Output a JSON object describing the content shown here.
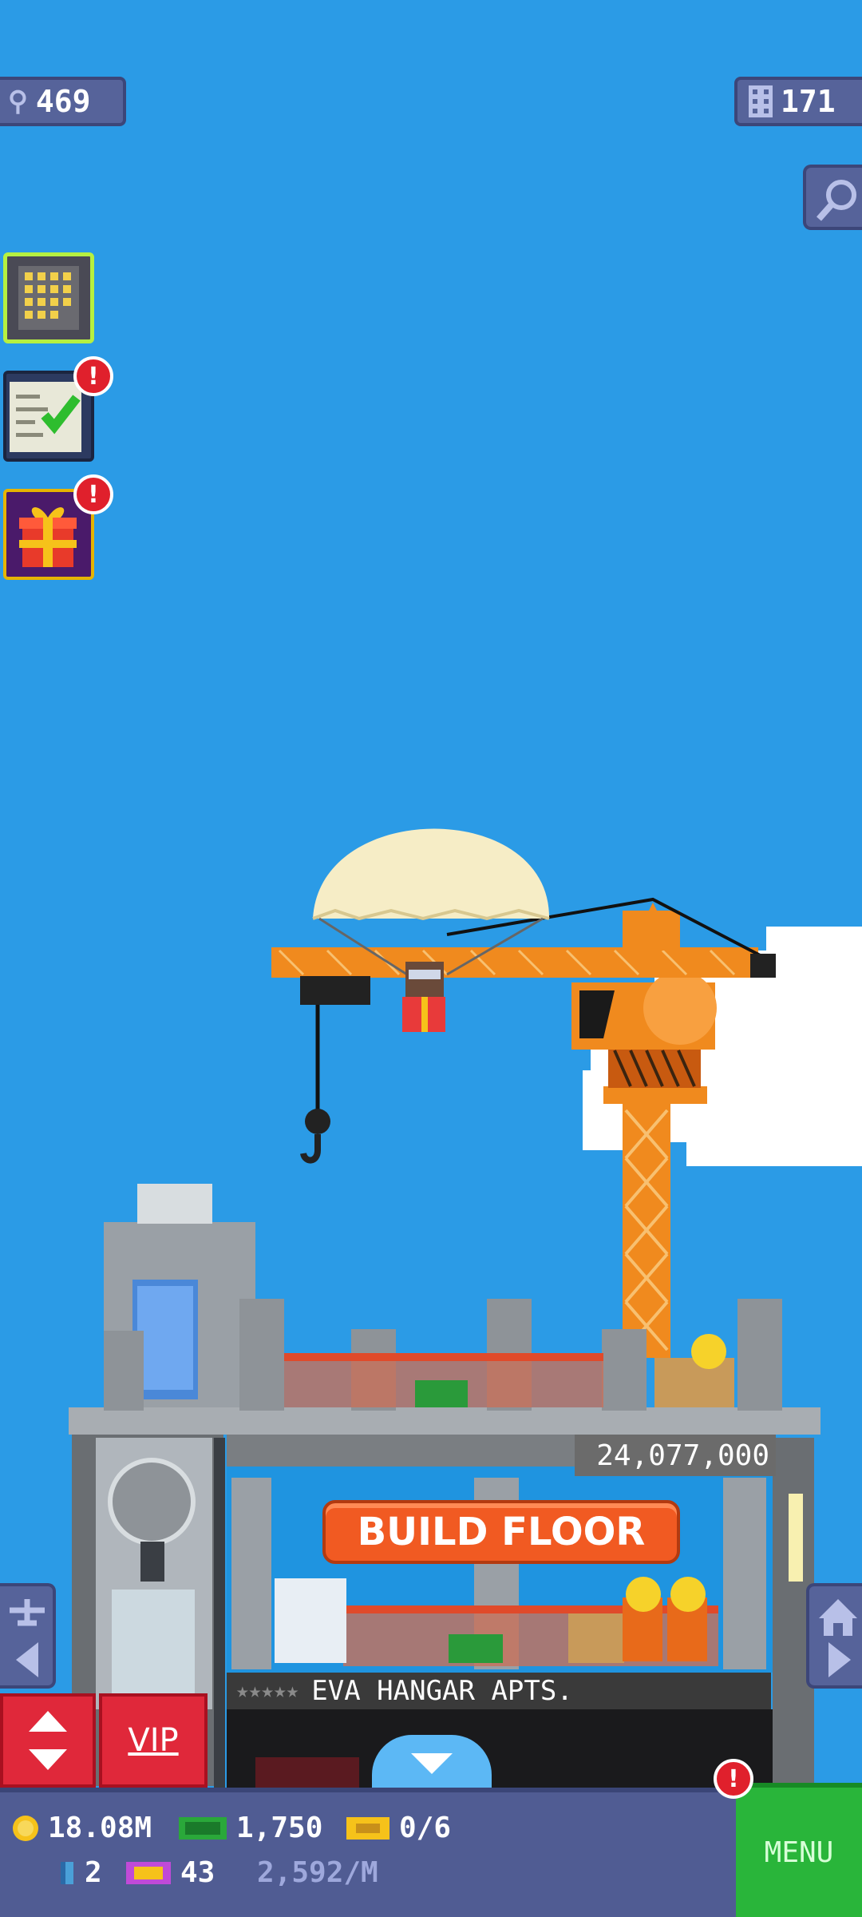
{
  "top_bar": {
    "population": "469",
    "population_icon": "person-icon",
    "floors": "171",
    "floors_icon": "building-grid-icon",
    "search_icon": "magnifier-icon"
  },
  "side_buttons": [
    {
      "name": "tower",
      "icon": "tower-icon",
      "alert": ""
    },
    {
      "name": "missions",
      "icon": "checklist-icon",
      "alert": "!"
    },
    {
      "name": "gifts",
      "icon": "gift-icon",
      "alert": "!"
    }
  ],
  "building": {
    "cost": "24,077,000",
    "build_label": "BUILD FLOOR",
    "floor_name": "EVA HANGAR APTS.",
    "floor_stars": "★★★★★"
  },
  "bottom_controls": {
    "vip_label": "VIP",
    "menu_label": "MENU",
    "menu_alert": "!"
  },
  "hud": {
    "coins": "18.08M",
    "bux": "1,750",
    "tickets": "0/6",
    "keys": "2",
    "items": "43",
    "rate": "2,592/M"
  },
  "colors": {
    "sky": "#2b9be6",
    "crane": "#f08a1e",
    "build_button": "#f15a22",
    "menu_button": "#29b53a",
    "vip_button": "#e0283a",
    "hud_bg": "#505c93"
  }
}
